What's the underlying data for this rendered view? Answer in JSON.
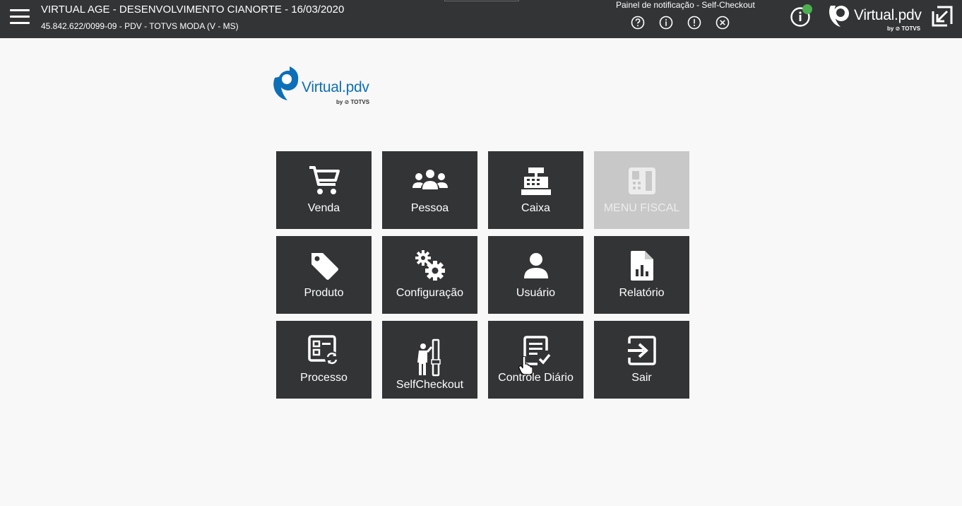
{
  "header": {
    "menu_icon": "hamburger-icon",
    "title": "VIRTUAL AGE - DESENVOLVIMENTO CIANORTE - 16/03/2020",
    "subtitle": "45.842.622/0099-09 - PDV - TOTVS MODA (V - MS)",
    "notification_label": "Painel de notificação - Self-Checkout",
    "notification_icons": [
      "question-circle-icon",
      "info-circle-icon",
      "exclamation-circle-icon",
      "close-circle-icon"
    ],
    "status_icon": "info-status-icon",
    "status_color": "#4caf50",
    "expand_icon": "expand-window-icon"
  },
  "logo": {
    "brand": "Virtual",
    "suffix": ".pdv",
    "by": "by",
    "company": "TOTVS",
    "accent_color": "#0d6fb8"
  },
  "tiles": [
    {
      "label": "Venda",
      "icon": "shopping-cart-icon",
      "enabled": true
    },
    {
      "label": "Pessoa",
      "icon": "users-group-icon",
      "enabled": true
    },
    {
      "label": "Caixa",
      "icon": "cash-register-icon",
      "enabled": true
    },
    {
      "label": "MENU FISCAL",
      "icon": "calculator-icon",
      "enabled": false
    },
    {
      "label": "Produto",
      "icon": "tag-icon",
      "enabled": true
    },
    {
      "label": "Configuração",
      "icon": "gears-icon",
      "enabled": true
    },
    {
      "label": "Usuário",
      "icon": "user-icon",
      "enabled": true
    },
    {
      "label": "Relatório",
      "icon": "report-file-icon",
      "enabled": true
    },
    {
      "label": "Processo",
      "icon": "process-icon",
      "enabled": true
    },
    {
      "label": "SelfCheckout",
      "icon": "self-checkout-icon",
      "enabled": true
    },
    {
      "label": "Controle Diário",
      "icon": "daily-control-icon",
      "enabled": true
    },
    {
      "label": "Sair",
      "icon": "sign-out-icon",
      "enabled": true
    }
  ],
  "colors": {
    "topbar": "#333436",
    "tile": "#333436",
    "tile_disabled": "#c8c8c8",
    "background": "#f8f8f8"
  }
}
